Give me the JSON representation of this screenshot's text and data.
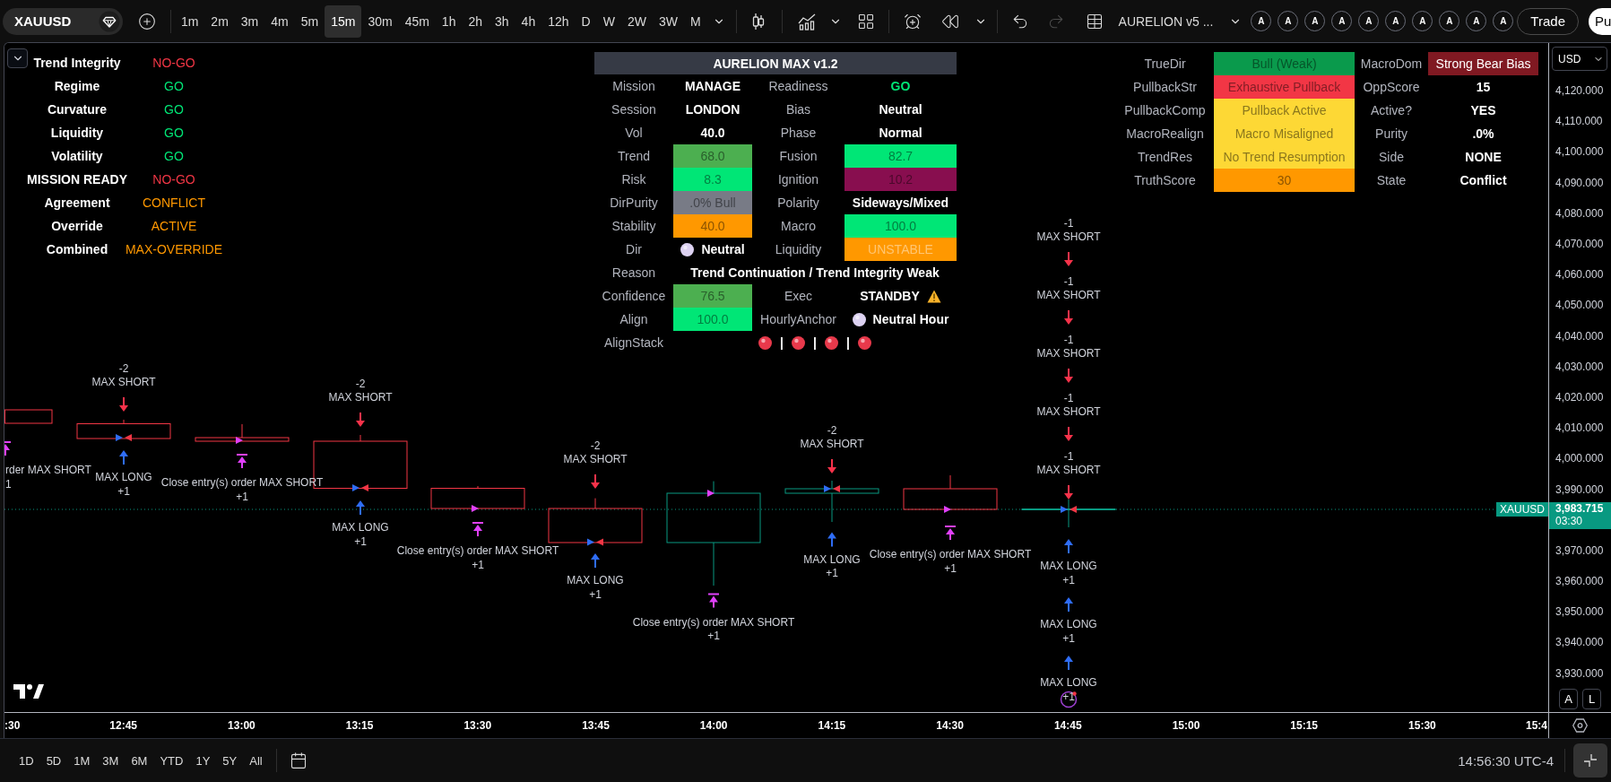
{
  "toolbar": {
    "symbol": "XAUUSD",
    "timeframes": [
      {
        "label": "1m",
        "selected": false
      },
      {
        "label": "2m",
        "selected": false
      },
      {
        "label": "3m",
        "selected": false
      },
      {
        "label": "4m",
        "selected": false
      },
      {
        "label": "5m",
        "selected": false
      },
      {
        "label": "15m",
        "selected": true
      },
      {
        "label": "30m",
        "selected": false
      },
      {
        "label": "45m",
        "selected": false
      },
      {
        "label": "1h",
        "selected": false
      },
      {
        "label": "2h",
        "selected": false
      },
      {
        "label": "3h",
        "selected": false
      },
      {
        "label": "4h",
        "selected": false
      },
      {
        "label": "12h",
        "selected": false
      },
      {
        "label": "D",
        "selected": false
      },
      {
        "label": "W",
        "selected": false
      },
      {
        "label": "2W",
        "selected": false
      },
      {
        "label": "3W",
        "selected": false
      },
      {
        "label": "M",
        "selected": false
      }
    ],
    "history": [
      {
        "kind": "undo",
        "disabled": false
      },
      {
        "kind": "redo",
        "disabled": true
      }
    ],
    "indicator": "AURELION v5 ...",
    "favorites": [
      "A",
      "A",
      "A",
      "A",
      "A",
      "A",
      "A",
      "A",
      "A",
      "A"
    ],
    "trade": "Trade",
    "publish": "Pu"
  },
  "left_panel": {
    "rows": [
      {
        "label": "Trend Integrity",
        "value": "NO-GO",
        "color": "#f23645"
      },
      {
        "label": "Regime",
        "value": "GO",
        "color": "#00e676"
      },
      {
        "label": "Curvature",
        "value": "GO",
        "color": "#00e676"
      },
      {
        "label": "Liquidity",
        "value": "GO",
        "color": "#00e676"
      },
      {
        "label": "Volatility",
        "value": "GO",
        "color": "#00e676"
      },
      {
        "label": "MISSION READY",
        "value": "NO-GO",
        "color": "#f23645"
      },
      {
        "label": "Agreement",
        "value": "CONFLICT",
        "color": "#ff9800"
      },
      {
        "label": "Override",
        "value": "ACTIVE",
        "color": "#ff9800"
      },
      {
        "label": "Combined",
        "value": "MAX-OVERRIDE",
        "color": "#ff9800"
      }
    ]
  },
  "center_panel": {
    "title": "AURELION MAX v1.2",
    "rows": [
      {
        "kind": "pair",
        "cells": [
          {
            "kind": "label",
            "text": "Mission"
          },
          {
            "kind": "value",
            "text": "MANAGE"
          },
          {
            "kind": "label",
            "text": "Readiness"
          },
          {
            "kind": "value",
            "text": "GO",
            "color": "#00e676"
          }
        ]
      },
      {
        "kind": "pair",
        "cells": [
          {
            "kind": "label",
            "text": "Session"
          },
          {
            "kind": "value",
            "text": "LONDON"
          },
          {
            "kind": "label",
            "text": "Bias"
          },
          {
            "kind": "value",
            "text": "Neutral"
          }
        ]
      },
      {
        "kind": "pair",
        "cells": [
          {
            "kind": "label",
            "text": "Vol"
          },
          {
            "kind": "value",
            "text": "40.0"
          },
          {
            "kind": "label",
            "text": "Phase"
          },
          {
            "kind": "value",
            "text": "Normal"
          }
        ]
      },
      {
        "kind": "pair",
        "cells": [
          {
            "kind": "label",
            "text": "Trend"
          },
          {
            "kind": "shaded",
            "text": "68.0",
            "color": "#4caf50"
          },
          {
            "kind": "label",
            "text": "Fusion"
          },
          {
            "kind": "shaded",
            "text": "82.7",
            "color": "#00e676"
          }
        ]
      },
      {
        "kind": "pair",
        "cells": [
          {
            "kind": "label",
            "text": "Risk"
          },
          {
            "kind": "shaded",
            "text": "8.3",
            "color": "#00e676"
          },
          {
            "kind": "label",
            "text": "Ignition"
          },
          {
            "kind": "shaded",
            "text": "10.2",
            "color": "#880e4f"
          }
        ]
      },
      {
        "kind": "pair",
        "cells": [
          {
            "kind": "label",
            "text": "DirPurity"
          },
          {
            "kind": "shaded",
            "text": ".0% Bull",
            "color": "#787b86"
          },
          {
            "kind": "label",
            "text": "Polarity"
          },
          {
            "kind": "value",
            "text": "Sideways/Mixed"
          }
        ]
      },
      {
        "kind": "pair",
        "cells": [
          {
            "kind": "label",
            "text": "Stability"
          },
          {
            "kind": "shaded",
            "text": "40.0",
            "color": "#ff9800"
          },
          {
            "kind": "label",
            "text": "Macro"
          },
          {
            "kind": "shaded",
            "text": "100.0",
            "color": "#00e676"
          }
        ]
      },
      {
        "kind": "pair",
        "cells": [
          {
            "kind": "label",
            "text": "Dir"
          },
          {
            "kind": "dot",
            "text": "Neutral",
            "dot": {
              "color": "#ddd2f2"
            }
          },
          {
            "kind": "label",
            "text": "Liquidity"
          },
          {
            "kind": "tinted",
            "text": "UNSTABLE",
            "color": "#ff9800"
          }
        ]
      },
      {
        "kind": "wide",
        "cells": [
          {
            "kind": "label",
            "text": "Reason"
          },
          {
            "kind": "value",
            "text": "Trend Continuation / Trend Integrity Weak"
          }
        ]
      },
      {
        "kind": "pair",
        "cells": [
          {
            "kind": "label",
            "text": "Confidence"
          },
          {
            "kind": "shaded",
            "text": "76.5",
            "color": "#4caf50"
          },
          {
            "kind": "label",
            "text": "Exec"
          },
          {
            "kind": "alert",
            "text": "STANDBY"
          }
        ]
      },
      {
        "kind": "pair",
        "cells": [
          {
            "kind": "label",
            "text": "Align"
          },
          {
            "kind": "shaded",
            "text": "100.0",
            "color": "#00e676"
          },
          {
            "kind": "label",
            "text": "HourlyAnchor"
          },
          {
            "kind": "dot",
            "text": "Neutral Hour",
            "dot": {
              "color": "#ddd2f2"
            }
          }
        ]
      },
      {
        "kind": "stack",
        "cells": [
          {
            "kind": "label",
            "text": "AlignStack"
          }
        ],
        "items": [
          {
            "kind": "dot",
            "color": "#e8394b"
          },
          {
            "kind": "sep",
            "text": "|"
          },
          {
            "kind": "dot",
            "color": "#e8394b"
          },
          {
            "kind": "sep",
            "text": "|"
          },
          {
            "kind": "dot",
            "color": "#e8394b"
          },
          {
            "kind": "sep",
            "text": "|"
          },
          {
            "kind": "dot",
            "color": "#e8394b"
          }
        ]
      }
    ]
  },
  "right_panel": {
    "rows": [
      {
        "kind": "pair",
        "cells": [
          {
            "kind": "label",
            "text": "TrueDir"
          },
          {
            "kind": "shaded",
            "text": "Bull (Weak)",
            "color": "#0a9a4c"
          },
          {
            "kind": "label",
            "text": "MacroDom"
          },
          {
            "kind": "inverse",
            "text": "Strong Bear Bias",
            "color": "#801922"
          }
        ]
      },
      {
        "kind": "pair",
        "cells": [
          {
            "kind": "label",
            "text": "PullbackStr"
          },
          {
            "kind": "shaded",
            "text": "Exhaustive Pullback",
            "color": "#f23645"
          },
          {
            "kind": "label",
            "text": "OppScore"
          },
          {
            "kind": "value",
            "text": "15"
          }
        ]
      },
      {
        "kind": "pair",
        "cells": [
          {
            "kind": "label",
            "text": "PullbackComp"
          },
          {
            "kind": "shaded",
            "text": "Pullback Active",
            "color": "#fdd835"
          },
          {
            "kind": "label",
            "text": "Active?"
          },
          {
            "kind": "value",
            "text": "YES"
          }
        ]
      },
      {
        "kind": "pair",
        "cells": [
          {
            "kind": "label",
            "text": "MacroRealign"
          },
          {
            "kind": "shaded",
            "text": "Macro Misaligned",
            "color": "#fdd835"
          },
          {
            "kind": "label",
            "text": "Purity"
          },
          {
            "kind": "value",
            "text": ".0%"
          }
        ]
      },
      {
        "kind": "pair",
        "cells": [
          {
            "kind": "label",
            "text": "TrendRes"
          },
          {
            "kind": "shaded",
            "text": "No Trend Resumption",
            "color": "#fdd835"
          },
          {
            "kind": "label",
            "text": "Side"
          },
          {
            "kind": "value",
            "text": "NONE"
          }
        ]
      },
      {
        "kind": "pair",
        "cells": [
          {
            "kind": "label",
            "text": "TruthScore"
          },
          {
            "kind": "shaded",
            "text": "30",
            "color": "#ff9800"
          },
          {
            "kind": "label",
            "text": "State"
          },
          {
            "kind": "value",
            "text": "Conflict"
          }
        ]
      }
    ]
  },
  "chart": {
    "candles": [
      {
        "kind": "bear",
        "signals": [
          {
            "kind": "close",
            "name": "rder MAX SHORT",
            "qty": "1"
          }
        ]
      },
      {
        "kind": "bear",
        "signals": [
          {
            "kind": "short",
            "qty": "-2",
            "name": "MAX SHORT"
          },
          {
            "kind": "long",
            "name": "MAX LONG",
            "qty": "+1"
          }
        ]
      },
      {
        "kind": "bear",
        "signals": [
          {
            "kind": "close",
            "name": "Close entry(s) order MAX SHORT",
            "qty": "+1"
          }
        ]
      },
      {
        "kind": "bear",
        "signals": [
          {
            "kind": "short",
            "qty": "-2",
            "name": "MAX SHORT"
          },
          {
            "kind": "long",
            "name": "MAX LONG",
            "qty": "+1"
          }
        ]
      },
      {
        "kind": "bear",
        "signals": [
          {
            "kind": "close",
            "name": "Close entry(s) order MAX SHORT",
            "qty": "+1"
          }
        ]
      },
      {
        "kind": "bear",
        "signals": [
          {
            "kind": "short",
            "qty": "-2",
            "name": "MAX SHORT"
          },
          {
            "kind": "long",
            "name": "MAX LONG",
            "qty": "+1"
          }
        ]
      },
      {
        "kind": "bull",
        "signals": [
          {
            "kind": "close",
            "name": "Close entry(s) order MAX SHORT",
            "qty": "+1"
          }
        ]
      },
      {
        "kind": "bull",
        "signals": [
          {
            "kind": "short",
            "qty": "-2",
            "name": "MAX SHORT"
          },
          {
            "kind": "long",
            "name": "MAX LONG",
            "qty": "+1"
          }
        ]
      },
      {
        "kind": "bear",
        "signals": [
          {
            "kind": "close",
            "name": "Close entry(s) order MAX SHORT",
            "qty": "+1"
          }
        ]
      },
      {
        "kind": "bull",
        "signals": [
          {
            "kind": "short",
            "qty": "-1",
            "name": "MAX SHORT"
          },
          {
            "kind": "short",
            "qty": "-1",
            "name": "MAX SHORT"
          },
          {
            "kind": "short",
            "qty": "-1",
            "name": "MAX SHORT"
          },
          {
            "kind": "short",
            "qty": "-1",
            "name": "MAX SHORT"
          },
          {
            "kind": "short",
            "qty": "-1",
            "name": "MAX SHORT"
          },
          {
            "kind": "long",
            "name": "MAX LONG",
            "qty": "+1"
          },
          {
            "kind": "long",
            "name": "MAX LONG",
            "qty": "+1"
          },
          {
            "kind": "long",
            "name": "MAX LONG",
            "qty": "+1"
          }
        ]
      }
    ],
    "price_tag": "XAUUSD"
  },
  "price_axis": {
    "currency": "USD",
    "ticks_above": [
      "4,120.000",
      "4,110.000",
      "4,100.000",
      "4,090.000",
      "4,080.000",
      "4,070.000",
      "4,060.000",
      "4,050.000",
      "4,040.000",
      "4,030.000",
      "4,020.000",
      "4,010.000",
      "4,000.000",
      "3,990.000"
    ],
    "current_price": "3,983.715",
    "countdown": "03:30",
    "ticks_below": [
      "3,970.000",
      "3,960.000",
      "3,950.000",
      "3,940.000",
      "3,930.000"
    ],
    "buttons": [
      "A",
      "L"
    ]
  },
  "time_axis": {
    "labels": [
      ":30",
      "12:45",
      "13:00",
      "13:15",
      "13:30",
      "13:45",
      "14:00",
      "14:15",
      "14:30",
      "14:45",
      "15:00",
      "15:15",
      "15:30",
      "15:4"
    ]
  },
  "bottom_bar": {
    "ranges": [
      {
        "label": "1D",
        "selected": false
      },
      {
        "label": "5D",
        "selected": false
      },
      {
        "label": "1M",
        "selected": false
      },
      {
        "label": "3M",
        "selected": false
      },
      {
        "label": "6M",
        "selected": false
      },
      {
        "label": "YTD",
        "selected": false
      },
      {
        "label": "1Y",
        "selected": false
      },
      {
        "label": "5Y",
        "selected": false
      },
      {
        "label": "All",
        "selected": false
      }
    ],
    "clock": "14:56:30 UTC-4"
  }
}
